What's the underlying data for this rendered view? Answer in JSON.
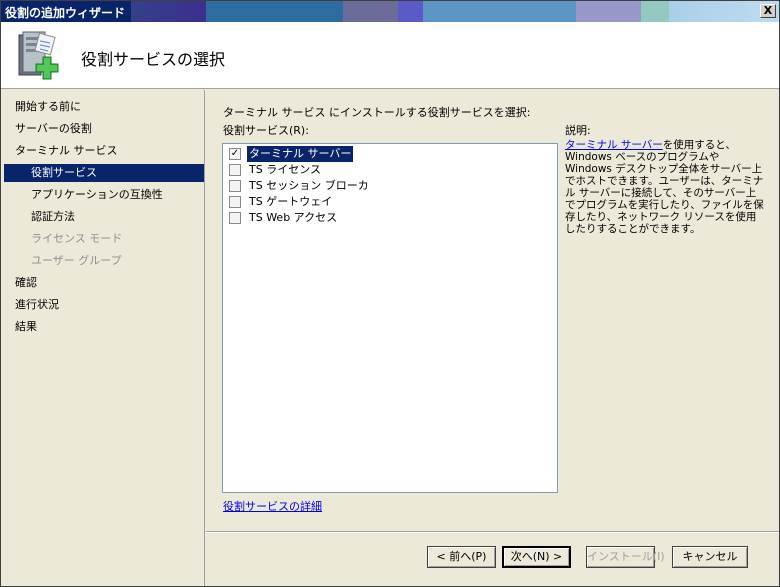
{
  "window": {
    "title": "役割の追加ウィザード",
    "close_label": "X"
  },
  "header": {
    "title": "役割サービスの選択",
    "icon": "server-role-add-icon"
  },
  "nav": {
    "items": [
      {
        "label": "開始する前に",
        "state": "normal"
      },
      {
        "label": "サーバーの役割",
        "state": "normal"
      },
      {
        "label": "ターミナル サービス",
        "state": "normal"
      },
      {
        "label": "役割サービス",
        "state": "active"
      },
      {
        "label": "アプリケーションの互換性",
        "state": "normal"
      },
      {
        "label": "認証方法",
        "state": "normal"
      },
      {
        "label": "ライセンス モード",
        "state": "disabled"
      },
      {
        "label": "ユーザー グループ",
        "state": "disabled"
      },
      {
        "label": "確認",
        "state": "normal"
      },
      {
        "label": "進行状況",
        "state": "normal"
      },
      {
        "label": "結果",
        "state": "normal"
      }
    ]
  },
  "main": {
    "prompt": "ターミナル サービス にインストールする役割サービスを選択:",
    "list_label": "役割サービス(R):",
    "services": [
      {
        "label": "ターミナル サーバー",
        "checked": true,
        "selected": true
      },
      {
        "label": "TS ライセンス",
        "checked": false,
        "selected": false
      },
      {
        "label": "TS セッション ブローカ",
        "checked": false,
        "selected": false
      },
      {
        "label": "TS ゲートウェイ",
        "checked": false,
        "selected": false
      },
      {
        "label": "TS Web アクセス",
        "checked": false,
        "selected": false
      }
    ],
    "description_heading": "説明:",
    "description_link": "ターミナル サーバー",
    "description_text": "を使用すると、Windows ベースのプログラムや Windows デスクトップ全体をサーバー上でホストできます。ユーザーは、ターミナル サーバーに接続して、そのサーバー上でプログラムを実行したり、ファイルを保存したり、ネットワーク リソースを使用したりすることができます。",
    "more_link": "役割サービスの詳細"
  },
  "footer": {
    "back": "< 前へ(P)",
    "next": "次へ(N) >",
    "install": "インストール(I)",
    "cancel": "キャンセル"
  },
  "colors": {
    "selection": "#0a246a",
    "link": "#0000ee"
  }
}
